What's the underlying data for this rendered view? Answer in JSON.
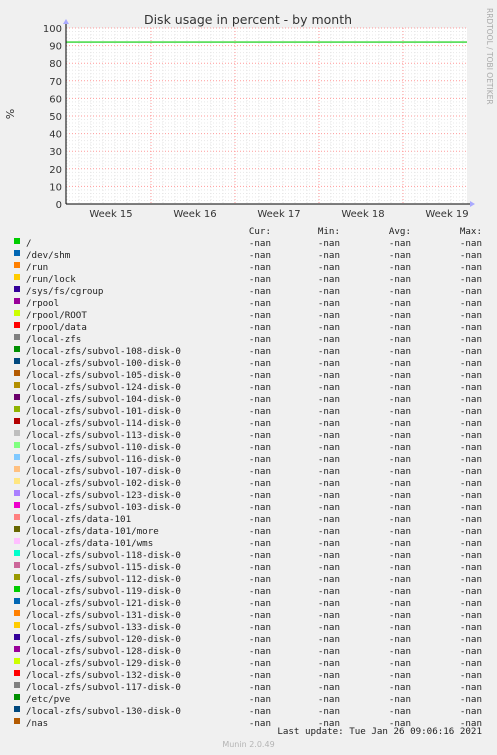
{
  "title": "Disk usage in percent - by month",
  "ylabel": "%",
  "side_label": "RRDTOOL / TOBI OETIKER",
  "chart_data": {
    "type": "line",
    "title": "Disk usage in percent - by month",
    "ylabel": "%",
    "ylim": [
      0,
      100
    ],
    "yticks": [
      0,
      10,
      20,
      30,
      40,
      50,
      60,
      70,
      80,
      90,
      100
    ],
    "x_tick_labels": [
      "Week 15",
      "Week 16",
      "Week 17",
      "Week 18",
      "Week 19"
    ],
    "grid": true,
    "threshold_line": {
      "value": 92,
      "color": "#00cc00"
    }
  },
  "legend": {
    "headers": {
      "cur": "Cur:",
      "min": "Min:",
      "avg": "Avg:",
      "max": "Max:"
    },
    "rows": [
      {
        "label": "/",
        "color": "#00cc00",
        "cur": "-nan",
        "min": "-nan",
        "avg": "-nan",
        "max": "-nan"
      },
      {
        "label": "/dev/shm",
        "color": "#0066b3",
        "cur": "-nan",
        "min": "-nan",
        "avg": "-nan",
        "max": "-nan"
      },
      {
        "label": "/run",
        "color": "#ff8000",
        "cur": "-nan",
        "min": "-nan",
        "avg": "-nan",
        "max": "-nan"
      },
      {
        "label": "/run/lock",
        "color": "#ffcc00",
        "cur": "-nan",
        "min": "-nan",
        "avg": "-nan",
        "max": "-nan"
      },
      {
        "label": "/sys/fs/cgroup",
        "color": "#330099",
        "cur": "-nan",
        "min": "-nan",
        "avg": "-nan",
        "max": "-nan"
      },
      {
        "label": "/rpool",
        "color": "#990099",
        "cur": "-nan",
        "min": "-nan",
        "avg": "-nan",
        "max": "-nan"
      },
      {
        "label": "/rpool/ROOT",
        "color": "#ccff00",
        "cur": "-nan",
        "min": "-nan",
        "avg": "-nan",
        "max": "-nan"
      },
      {
        "label": "/rpool/data",
        "color": "#ff0000",
        "cur": "-nan",
        "min": "-nan",
        "avg": "-nan",
        "max": "-nan"
      },
      {
        "label": "/local-zfs",
        "color": "#808080",
        "cur": "-nan",
        "min": "-nan",
        "avg": "-nan",
        "max": "-nan"
      },
      {
        "label": "/local-zfs/subvol-108-disk-0",
        "color": "#008f00",
        "cur": "-nan",
        "min": "-nan",
        "avg": "-nan",
        "max": "-nan"
      },
      {
        "label": "/local-zfs/subvol-100-disk-0",
        "color": "#00487d",
        "cur": "-nan",
        "min": "-nan",
        "avg": "-nan",
        "max": "-nan"
      },
      {
        "label": "/local-zfs/subvol-105-disk-0",
        "color": "#b35a00",
        "cur": "-nan",
        "min": "-nan",
        "avg": "-nan",
        "max": "-nan"
      },
      {
        "label": "/local-zfs/subvol-124-disk-0",
        "color": "#b38f00",
        "cur": "-nan",
        "min": "-nan",
        "avg": "-nan",
        "max": "-nan"
      },
      {
        "label": "/local-zfs/subvol-104-disk-0",
        "color": "#6b006b",
        "cur": "-nan",
        "min": "-nan",
        "avg": "-nan",
        "max": "-nan"
      },
      {
        "label": "/local-zfs/subvol-101-disk-0",
        "color": "#8fb300",
        "cur": "-nan",
        "min": "-nan",
        "avg": "-nan",
        "max": "-nan"
      },
      {
        "label": "/local-zfs/subvol-114-disk-0",
        "color": "#b30000",
        "cur": "-nan",
        "min": "-nan",
        "avg": "-nan",
        "max": "-nan"
      },
      {
        "label": "/local-zfs/subvol-113-disk-0",
        "color": "#bebebe",
        "cur": "-nan",
        "min": "-nan",
        "avg": "-nan",
        "max": "-nan"
      },
      {
        "label": "/local-zfs/subvol-110-disk-0",
        "color": "#80ff80",
        "cur": "-nan",
        "min": "-nan",
        "avg": "-nan",
        "max": "-nan"
      },
      {
        "label": "/local-zfs/subvol-116-disk-0",
        "color": "#80c9ff",
        "cur": "-nan",
        "min": "-nan",
        "avg": "-nan",
        "max": "-nan"
      },
      {
        "label": "/local-zfs/subvol-107-disk-0",
        "color": "#ffc080",
        "cur": "-nan",
        "min": "-nan",
        "avg": "-nan",
        "max": "-nan"
      },
      {
        "label": "/local-zfs/subvol-102-disk-0",
        "color": "#ffe680",
        "cur": "-nan",
        "min": "-nan",
        "avg": "-nan",
        "max": "-nan"
      },
      {
        "label": "/local-zfs/subvol-123-disk-0",
        "color": "#aa80ff",
        "cur": "-nan",
        "min": "-nan",
        "avg": "-nan",
        "max": "-nan"
      },
      {
        "label": "/local-zfs/subvol-103-disk-0",
        "color": "#ee00cc",
        "cur": "-nan",
        "min": "-nan",
        "avg": "-nan",
        "max": "-nan"
      },
      {
        "label": "/local-zfs/data-101",
        "color": "#ff8080",
        "cur": "-nan",
        "min": "-nan",
        "avg": "-nan",
        "max": "-nan"
      },
      {
        "label": "/local-zfs/data-101/more",
        "color": "#666600",
        "cur": "-nan",
        "min": "-nan",
        "avg": "-nan",
        "max": "-nan"
      },
      {
        "label": "/local-zfs/data-101/wms",
        "color": "#ffbfff",
        "cur": "-nan",
        "min": "-nan",
        "avg": "-nan",
        "max": "-nan"
      },
      {
        "label": "/local-zfs/subvol-118-disk-0",
        "color": "#00ffcc",
        "cur": "-nan",
        "min": "-nan",
        "avg": "-nan",
        "max": "-nan"
      },
      {
        "label": "/local-zfs/subvol-115-disk-0",
        "color": "#cc6699",
        "cur": "-nan",
        "min": "-nan",
        "avg": "-nan",
        "max": "-nan"
      },
      {
        "label": "/local-zfs/subvol-112-disk-0",
        "color": "#999900",
        "cur": "-nan",
        "min": "-nan",
        "avg": "-nan",
        "max": "-nan"
      },
      {
        "label": "/local-zfs/subvol-119-disk-0",
        "color": "#00cc00",
        "cur": "-nan",
        "min": "-nan",
        "avg": "-nan",
        "max": "-nan"
      },
      {
        "label": "/local-zfs/subvol-121-disk-0",
        "color": "#0066b3",
        "cur": "-nan",
        "min": "-nan",
        "avg": "-nan",
        "max": "-nan"
      },
      {
        "label": "/local-zfs/subvol-131-disk-0",
        "color": "#ff8000",
        "cur": "-nan",
        "min": "-nan",
        "avg": "-nan",
        "max": "-nan"
      },
      {
        "label": "/local-zfs/subvol-133-disk-0",
        "color": "#ffcc00",
        "cur": "-nan",
        "min": "-nan",
        "avg": "-nan",
        "max": "-nan"
      },
      {
        "label": "/local-zfs/subvol-120-disk-0",
        "color": "#330099",
        "cur": "-nan",
        "min": "-nan",
        "avg": "-nan",
        "max": "-nan"
      },
      {
        "label": "/local-zfs/subvol-128-disk-0",
        "color": "#990099",
        "cur": "-nan",
        "min": "-nan",
        "avg": "-nan",
        "max": "-nan"
      },
      {
        "label": "/local-zfs/subvol-129-disk-0",
        "color": "#ccff00",
        "cur": "-nan",
        "min": "-nan",
        "avg": "-nan",
        "max": "-nan"
      },
      {
        "label": "/local-zfs/subvol-132-disk-0",
        "color": "#ff0000",
        "cur": "-nan",
        "min": "-nan",
        "avg": "-nan",
        "max": "-nan"
      },
      {
        "label": "/local-zfs/subvol-117-disk-0",
        "color": "#808080",
        "cur": "-nan",
        "min": "-nan",
        "avg": "-nan",
        "max": "-nan"
      },
      {
        "label": "/etc/pve",
        "color": "#008f00",
        "cur": "-nan",
        "min": "-nan",
        "avg": "-nan",
        "max": "-nan"
      },
      {
        "label": "/local-zfs/subvol-130-disk-0",
        "color": "#00487d",
        "cur": "-nan",
        "min": "-nan",
        "avg": "-nan",
        "max": "-nan"
      },
      {
        "label": "/nas",
        "color": "#b35a00",
        "cur": "-nan",
        "min": "-nan",
        "avg": "-nan",
        "max": "-nan"
      }
    ]
  },
  "last_update": "Last update: Tue Jan 26 09:06:16 2021",
  "footer": "Munin 2.0.49"
}
